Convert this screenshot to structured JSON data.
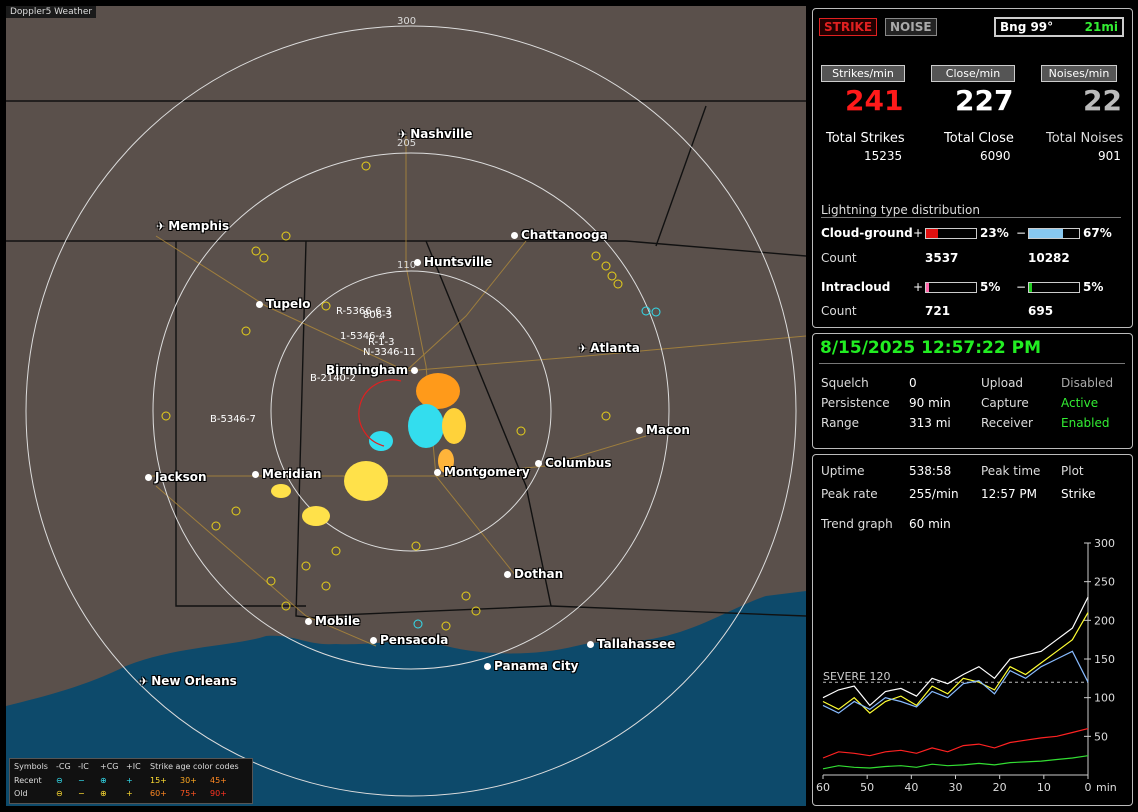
{
  "app_title": "Doppler5 Weather",
  "map": {
    "rings": [
      "300",
      "205",
      "110"
    ],
    "cities": [
      {
        "name": "Nashville",
        "icon": "airport-icon"
      },
      {
        "name": "Memphis",
        "icon": "airport-icon"
      },
      {
        "name": "Chattanooga",
        "icon": "city-dot"
      },
      {
        "name": "Huntsville",
        "icon": "city-dot"
      },
      {
        "name": "Tupelo",
        "icon": "city-dot"
      },
      {
        "name": "Atlanta",
        "icon": "airport-icon"
      },
      {
        "name": "Birmingham",
        "icon": "city-dot"
      },
      {
        "name": "Macon",
        "icon": "city-dot"
      },
      {
        "name": "Jackson",
        "icon": "city-dot"
      },
      {
        "name": "Meridian",
        "icon": "city-dot"
      },
      {
        "name": "Montgomery",
        "icon": "city-dot"
      },
      {
        "name": "Columbus",
        "icon": "city-dot"
      },
      {
        "name": "Dothan",
        "icon": "city-dot"
      },
      {
        "name": "Mobile",
        "icon": "city-dot"
      },
      {
        "name": "Pensacola",
        "icon": "city-dot"
      },
      {
        "name": "Tallahassee",
        "icon": "city-dot"
      },
      {
        "name": "Panama City",
        "icon": "city-dot"
      },
      {
        "name": "New Orleans",
        "icon": "airport-icon"
      }
    ],
    "storm_tags": [
      "R-5366-6-3",
      "806-3",
      "1-5346-4",
      "R-1-3",
      "N-3346-11",
      "B-2140-2",
      "B-5346-7"
    ],
    "legend": {
      "title_symbols": "Symbols",
      "cols": [
        "-CG",
        "-IC",
        "+CG",
        "+IC"
      ],
      "age_title": "Strike age color codes",
      "recent_label": "Recent",
      "old_label": "Old",
      "recent_ages": [
        "15+",
        "30+",
        "45+"
      ],
      "old_ages": [
        "60+",
        "75+",
        "90+"
      ]
    }
  },
  "top": {
    "strike_btn": "STRIKE",
    "noise_btn": "NOISE",
    "bearing": "Bng 99°",
    "distance": "21mi",
    "strikes_min_label": "Strikes/min",
    "close_min_label": "Close/min",
    "noises_min_label": "Noises/min",
    "strikes_min": "241",
    "close_min": "227",
    "noises_min": "22",
    "total_strikes_label": "Total Strikes",
    "total_close_label": "Total Close",
    "total_noises_label": "Total Noises",
    "total_strikes": "15235",
    "total_close": "6090",
    "total_noises": "901",
    "dist_title": "Lightning type distribution",
    "cg_label": "Cloud-ground",
    "ic_label": "Intracloud",
    "count_label": "Count",
    "plus": "+",
    "minus": "−",
    "cg_pos_pct": "23%",
    "cg_neg_pct": "67%",
    "cg_pos_count": "3537",
    "cg_neg_count": "10282",
    "ic_pos_pct": "5%",
    "ic_neg_pct": "5%",
    "ic_pos_count": "721",
    "ic_neg_count": "695",
    "cg_pos_frac": 0.23,
    "cg_neg_frac": 0.67,
    "ic_pos_frac": 0.05,
    "ic_neg_frac": 0.05
  },
  "status": {
    "datetime": "8/15/2025 12:57:22 PM",
    "squelch_label": "Squelch",
    "squelch": "0",
    "persistence_label": "Persistence",
    "persistence": "90 min",
    "range_label": "Range",
    "range": "313 mi",
    "upload_label": "Upload",
    "upload": "Disabled",
    "capture_label": "Capture",
    "capture": "Active",
    "receiver_label": "Receiver",
    "receiver": "Enabled"
  },
  "trend": {
    "uptime_label": "Uptime",
    "uptime": "538:58",
    "peak_time_label": "Peak time",
    "peak_time": "12:57 PM",
    "plot_label": "Plot",
    "plot": "Strike",
    "peak_rate_label": "Peak rate",
    "peak_rate": "255/min",
    "trend_label": "Trend graph",
    "trend_window": "60 min",
    "severe_label": "SEVERE 120",
    "unit": "min"
  },
  "chart_data": {
    "type": "line",
    "x": [
      60,
      50,
      40,
      30,
      20,
      10,
      0
    ],
    "xlabel": "min",
    "ylim": [
      0,
      300
    ],
    "yticks": [
      50,
      100,
      150,
      200,
      250,
      300
    ],
    "threshold": {
      "label": "SEVERE 120",
      "value": 120
    },
    "series": [
      {
        "color": "#ffffff",
        "values": [
          100,
          110,
          115,
          90,
          108,
          112,
          102,
          125,
          118,
          130,
          140,
          125,
          150,
          155,
          160,
          175,
          190,
          230
        ]
      },
      {
        "color": "#ffff33",
        "values": [
          95,
          85,
          100,
          80,
          95,
          102,
          90,
          115,
          105,
          125,
          120,
          110,
          140,
          130,
          145,
          160,
          175,
          210
        ]
      },
      {
        "color": "#88bbff",
        "values": [
          90,
          80,
          95,
          85,
          100,
          95,
          88,
          108,
          100,
          118,
          122,
          105,
          135,
          125,
          140,
          150,
          160,
          120
        ]
      },
      {
        "color": "#ff2222",
        "values": [
          22,
          30,
          28,
          25,
          30,
          32,
          28,
          35,
          30,
          38,
          40,
          35,
          42,
          45,
          48,
          50,
          55,
          60
        ]
      },
      {
        "color": "#33dd33",
        "values": [
          8,
          12,
          10,
          9,
          11,
          12,
          10,
          14,
          12,
          13,
          15,
          13,
          16,
          17,
          18,
          20,
          22,
          25
        ]
      }
    ]
  }
}
